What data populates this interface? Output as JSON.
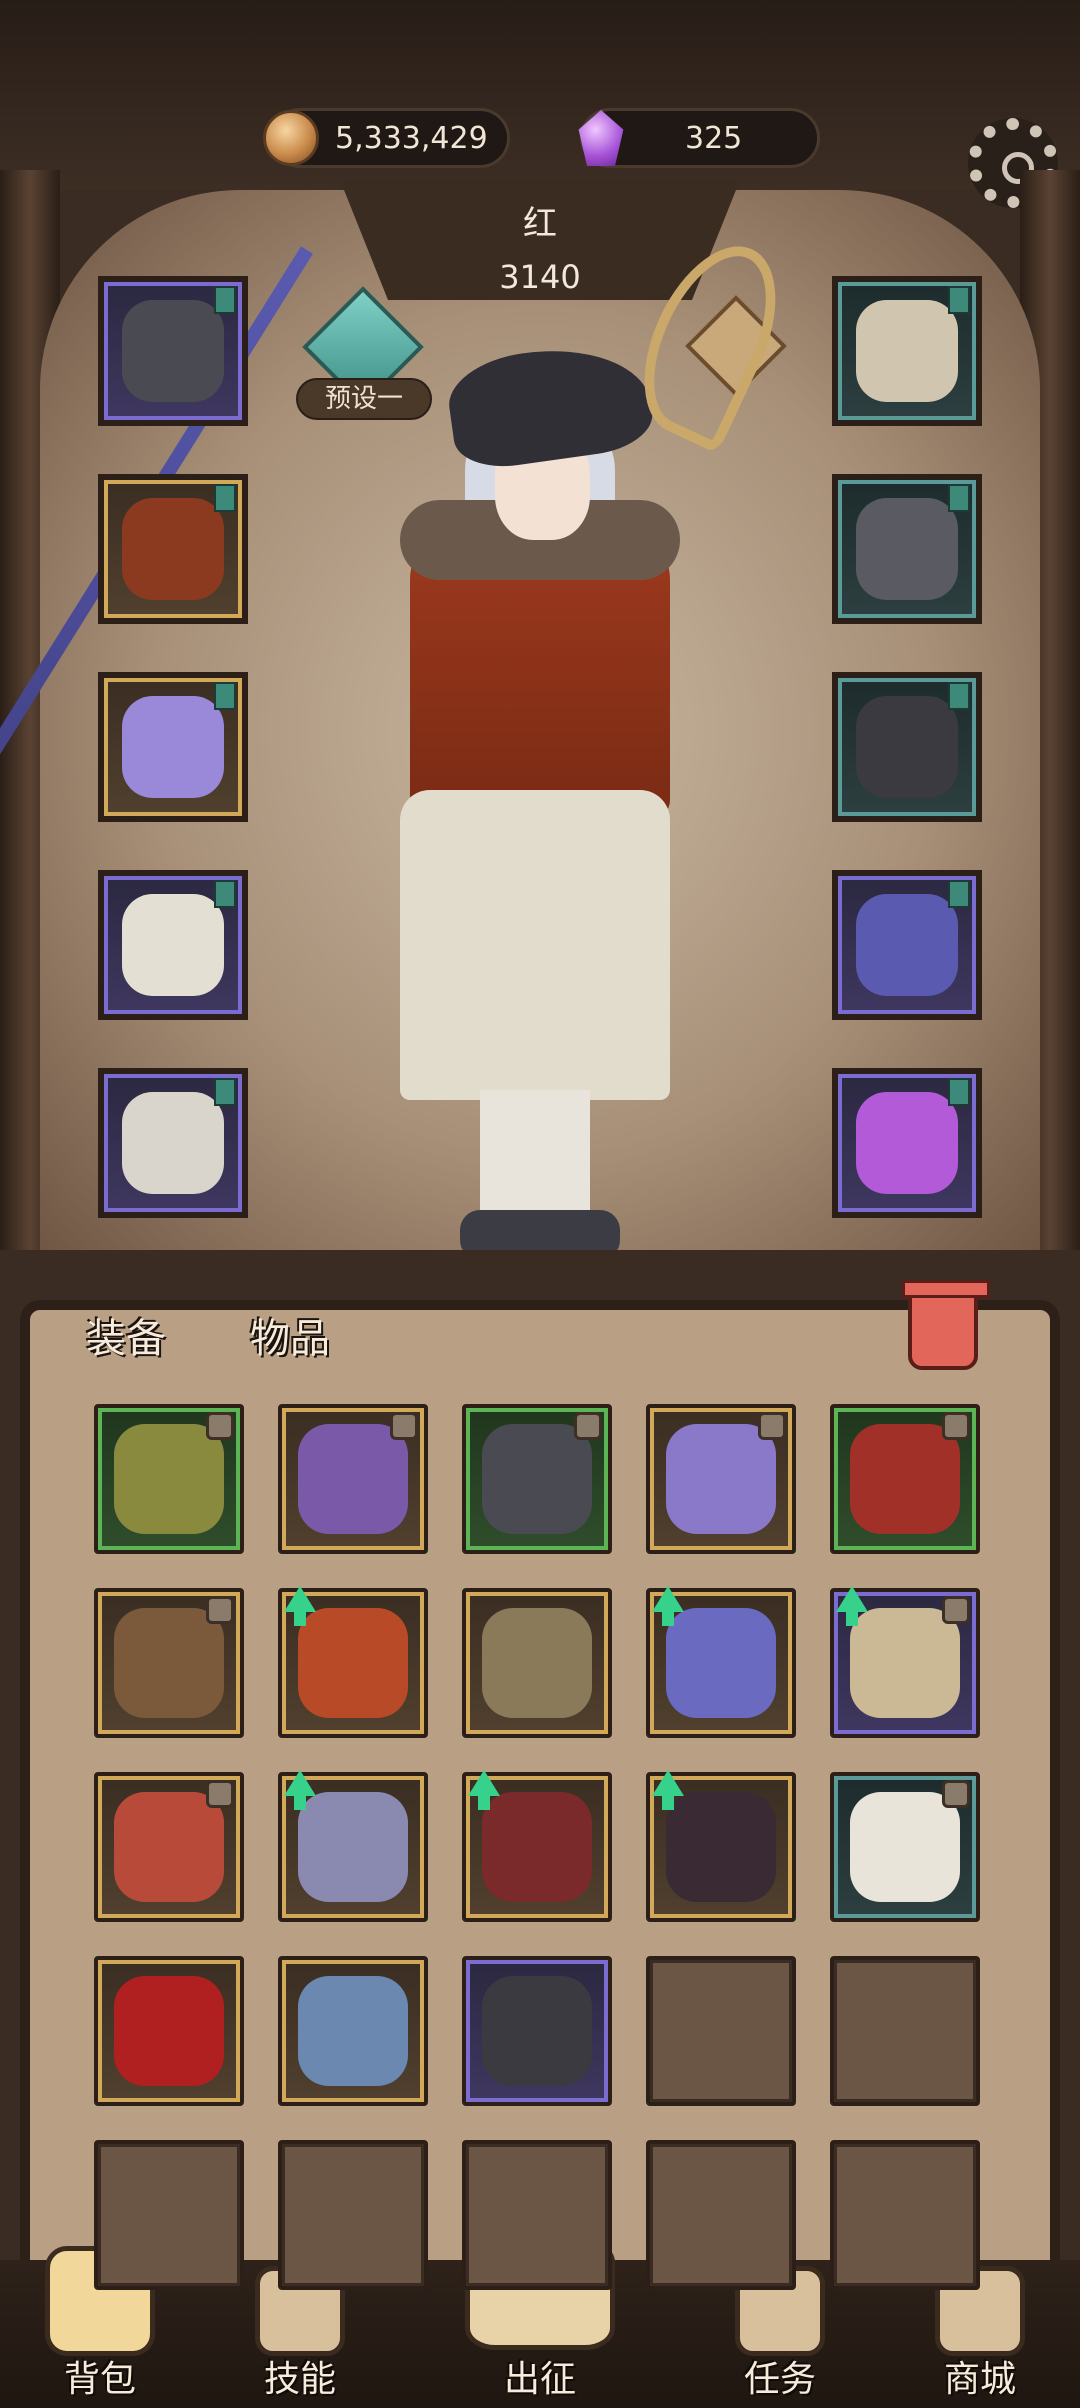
{
  "currencies": [
    {
      "name": "coin-icon",
      "value": "5,333,429"
    },
    {
      "name": "crystal-icon",
      "value": "325"
    }
  ],
  "character": {
    "name": "红",
    "power": "3140",
    "preset_label": "预设一"
  },
  "tabs": [
    {
      "label": "装备",
      "active": true
    },
    {
      "label": "物品",
      "active": false
    }
  ],
  "nav": [
    {
      "label": "背包",
      "icon": "backpack-icon",
      "active": true
    },
    {
      "label": "技能",
      "icon": "skill-icon",
      "active": false
    },
    {
      "label": "出征",
      "icon": "battle-icon",
      "active": false
    },
    {
      "label": "任务",
      "icon": "quest-icon",
      "active": false
    },
    {
      "label": "商城",
      "icon": "shop-icon",
      "active": false
    }
  ],
  "equipment_left": [
    {
      "slot": "hat",
      "rarity": "purple",
      "color": "#4a4a52"
    },
    {
      "slot": "coat",
      "rarity": "gold",
      "color": "#8b3a20"
    },
    {
      "slot": "gloves",
      "rarity": "gold",
      "color": "#9a88d8"
    },
    {
      "slot": "pants",
      "rarity": "purple",
      "color": "#e4dfd3"
    },
    {
      "slot": "boots",
      "rarity": "purple",
      "color": "#d9d5cc"
    }
  ],
  "equipment_right": [
    {
      "slot": "amulet",
      "rarity": "teal",
      "color": "#d0c6b0"
    },
    {
      "slot": "ring",
      "rarity": "teal",
      "color": "#5a5a62"
    },
    {
      "slot": "bracer",
      "rarity": "teal",
      "color": "#3a3a40"
    },
    {
      "slot": "staff",
      "rarity": "purple",
      "color": "#5a5ab0"
    },
    {
      "slot": "orb",
      "rarity": "purple",
      "color": "#b25ad8"
    }
  ],
  "inventory": [
    {
      "rarity": "green",
      "color": "#8a8a3e",
      "locked": true,
      "upgrade": false
    },
    {
      "rarity": "gold",
      "color": "#7a5aa8",
      "locked": true,
      "upgrade": false
    },
    {
      "rarity": "green",
      "color": "#4a4a52",
      "locked": true,
      "upgrade": false
    },
    {
      "rarity": "gold",
      "color": "#8a78c8",
      "locked": true,
      "upgrade": false
    },
    {
      "rarity": "green",
      "color": "#a03028",
      "locked": true,
      "upgrade": false
    },
    {
      "rarity": "gold",
      "color": "#7a5a3a",
      "locked": true,
      "upgrade": false
    },
    {
      "rarity": "gold",
      "color": "#b84a28",
      "locked": false,
      "upgrade": true
    },
    {
      "rarity": "gold",
      "color": "#8a7a5a",
      "locked": false,
      "upgrade": false
    },
    {
      "rarity": "gold",
      "color": "#6a6ac0",
      "locked": false,
      "upgrade": true
    },
    {
      "rarity": "purple",
      "color": "#cbb894",
      "locked": true,
      "upgrade": true
    },
    {
      "rarity": "gold",
      "color": "#b84a3a",
      "locked": true,
      "upgrade": false
    },
    {
      "rarity": "gold",
      "color": "#8a8ab0",
      "locked": false,
      "upgrade": true
    },
    {
      "rarity": "gold",
      "color": "#7a2a2a",
      "locked": false,
      "upgrade": true
    },
    {
      "rarity": "gold",
      "color": "#3a2a34",
      "locked": false,
      "upgrade": true
    },
    {
      "rarity": "teal",
      "color": "#e8e4da",
      "locked": true,
      "upgrade": false
    },
    {
      "rarity": "gold",
      "color": "#b02020",
      "locked": false,
      "upgrade": false
    },
    {
      "rarity": "gold",
      "color": "#6a88b0",
      "locked": false,
      "upgrade": false
    },
    {
      "rarity": "purple",
      "color": "#3a3a40",
      "locked": false,
      "upgrade": false
    },
    {
      "rarity": "empty"
    },
    {
      "rarity": "empty"
    },
    {
      "rarity": "empty"
    },
    {
      "rarity": "empty"
    },
    {
      "rarity": "empty"
    },
    {
      "rarity": "empty"
    },
    {
      "rarity": "empty"
    }
  ]
}
